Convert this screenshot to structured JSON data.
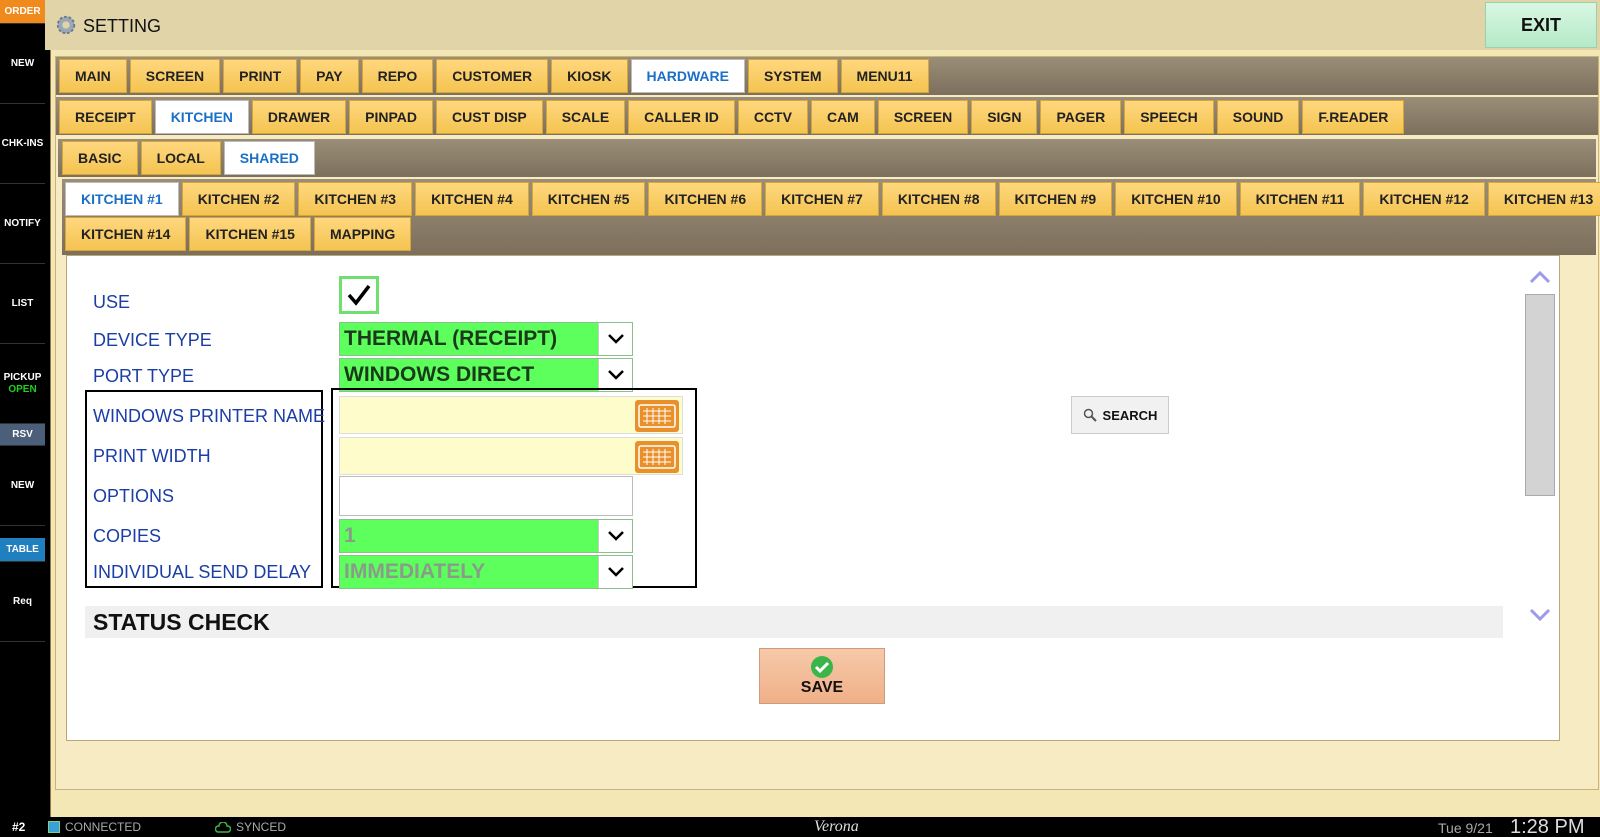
{
  "sidebar": {
    "order": "ORDER",
    "items": [
      "NEW",
      "CHK-INS",
      "NOTIFY",
      "LIST",
      "PICKUP",
      "RSV",
      "NEW",
      "TABLE",
      "Req"
    ],
    "pickup_sub": "OPEN"
  },
  "header": {
    "title": "SETTING",
    "exit_label": "EXIT"
  },
  "tabs_main": [
    "MAIN",
    "SCREEN",
    "PRINT",
    "PAY",
    "REPO",
    "CUSTOMER",
    "KIOSK",
    "HARDWARE",
    "SYSTEM",
    "MENU11"
  ],
  "tabs_hardware": [
    "RECEIPT",
    "KITCHEN",
    "DRAWER",
    "PINPAD",
    "CUST DISP",
    "SCALE",
    "CALLER ID",
    "CCTV",
    "CAM",
    "SCREEN",
    "SIGN",
    "PAGER",
    "SPEECH",
    "SOUND",
    "F.READER"
  ],
  "tabs_scope": [
    "BASIC",
    "LOCAL",
    "SHARED"
  ],
  "tabs_kitchen_row1": [
    "KITCHEN #1",
    "KITCHEN #2",
    "KITCHEN #3",
    "KITCHEN #4",
    "KITCHEN #5",
    "KITCHEN #6",
    "KITCHEN #7",
    "KITCHEN #8",
    "KITCHEN #9",
    "KITCHEN #10",
    "KITCHEN #11",
    "KITCHEN #12",
    "KITCHEN #13"
  ],
  "tabs_kitchen_row2": [
    "KITCHEN #14",
    "KITCHEN #15",
    "MAPPING"
  ],
  "form": {
    "use_label": "USE",
    "use_checked": true,
    "device_type_label": "DEVICE TYPE",
    "device_type_value": "THERMAL (RECEIPT)",
    "port_type_label": "PORT TYPE",
    "port_type_value": "WINDOWS DIRECT",
    "printer_name_label": "WINDOWS PRINTER NAME",
    "printer_name_value": "",
    "print_width_label": "PRINT WIDTH",
    "print_width_value": "",
    "options_label": "OPTIONS",
    "options_value": "",
    "copies_label": "COPIES",
    "copies_value": "1",
    "send_delay_label": "INDIVIDUAL SEND DELAY",
    "send_delay_value": "IMMEDIATELY",
    "search_label": "SEARCH",
    "status_check_heading": "STATUS CHECK",
    "save_label": "SAVE"
  },
  "status": {
    "station": "#2",
    "connected": "CONNECTED",
    "synced": "SYNCED",
    "store": "Verona",
    "date": "Tue 9/21",
    "time": "1:28 PM"
  },
  "colors": {
    "tab_active_text": "#1a6fc6",
    "field_green": "#5dff5d",
    "label_blue": "#1b3ea6"
  }
}
